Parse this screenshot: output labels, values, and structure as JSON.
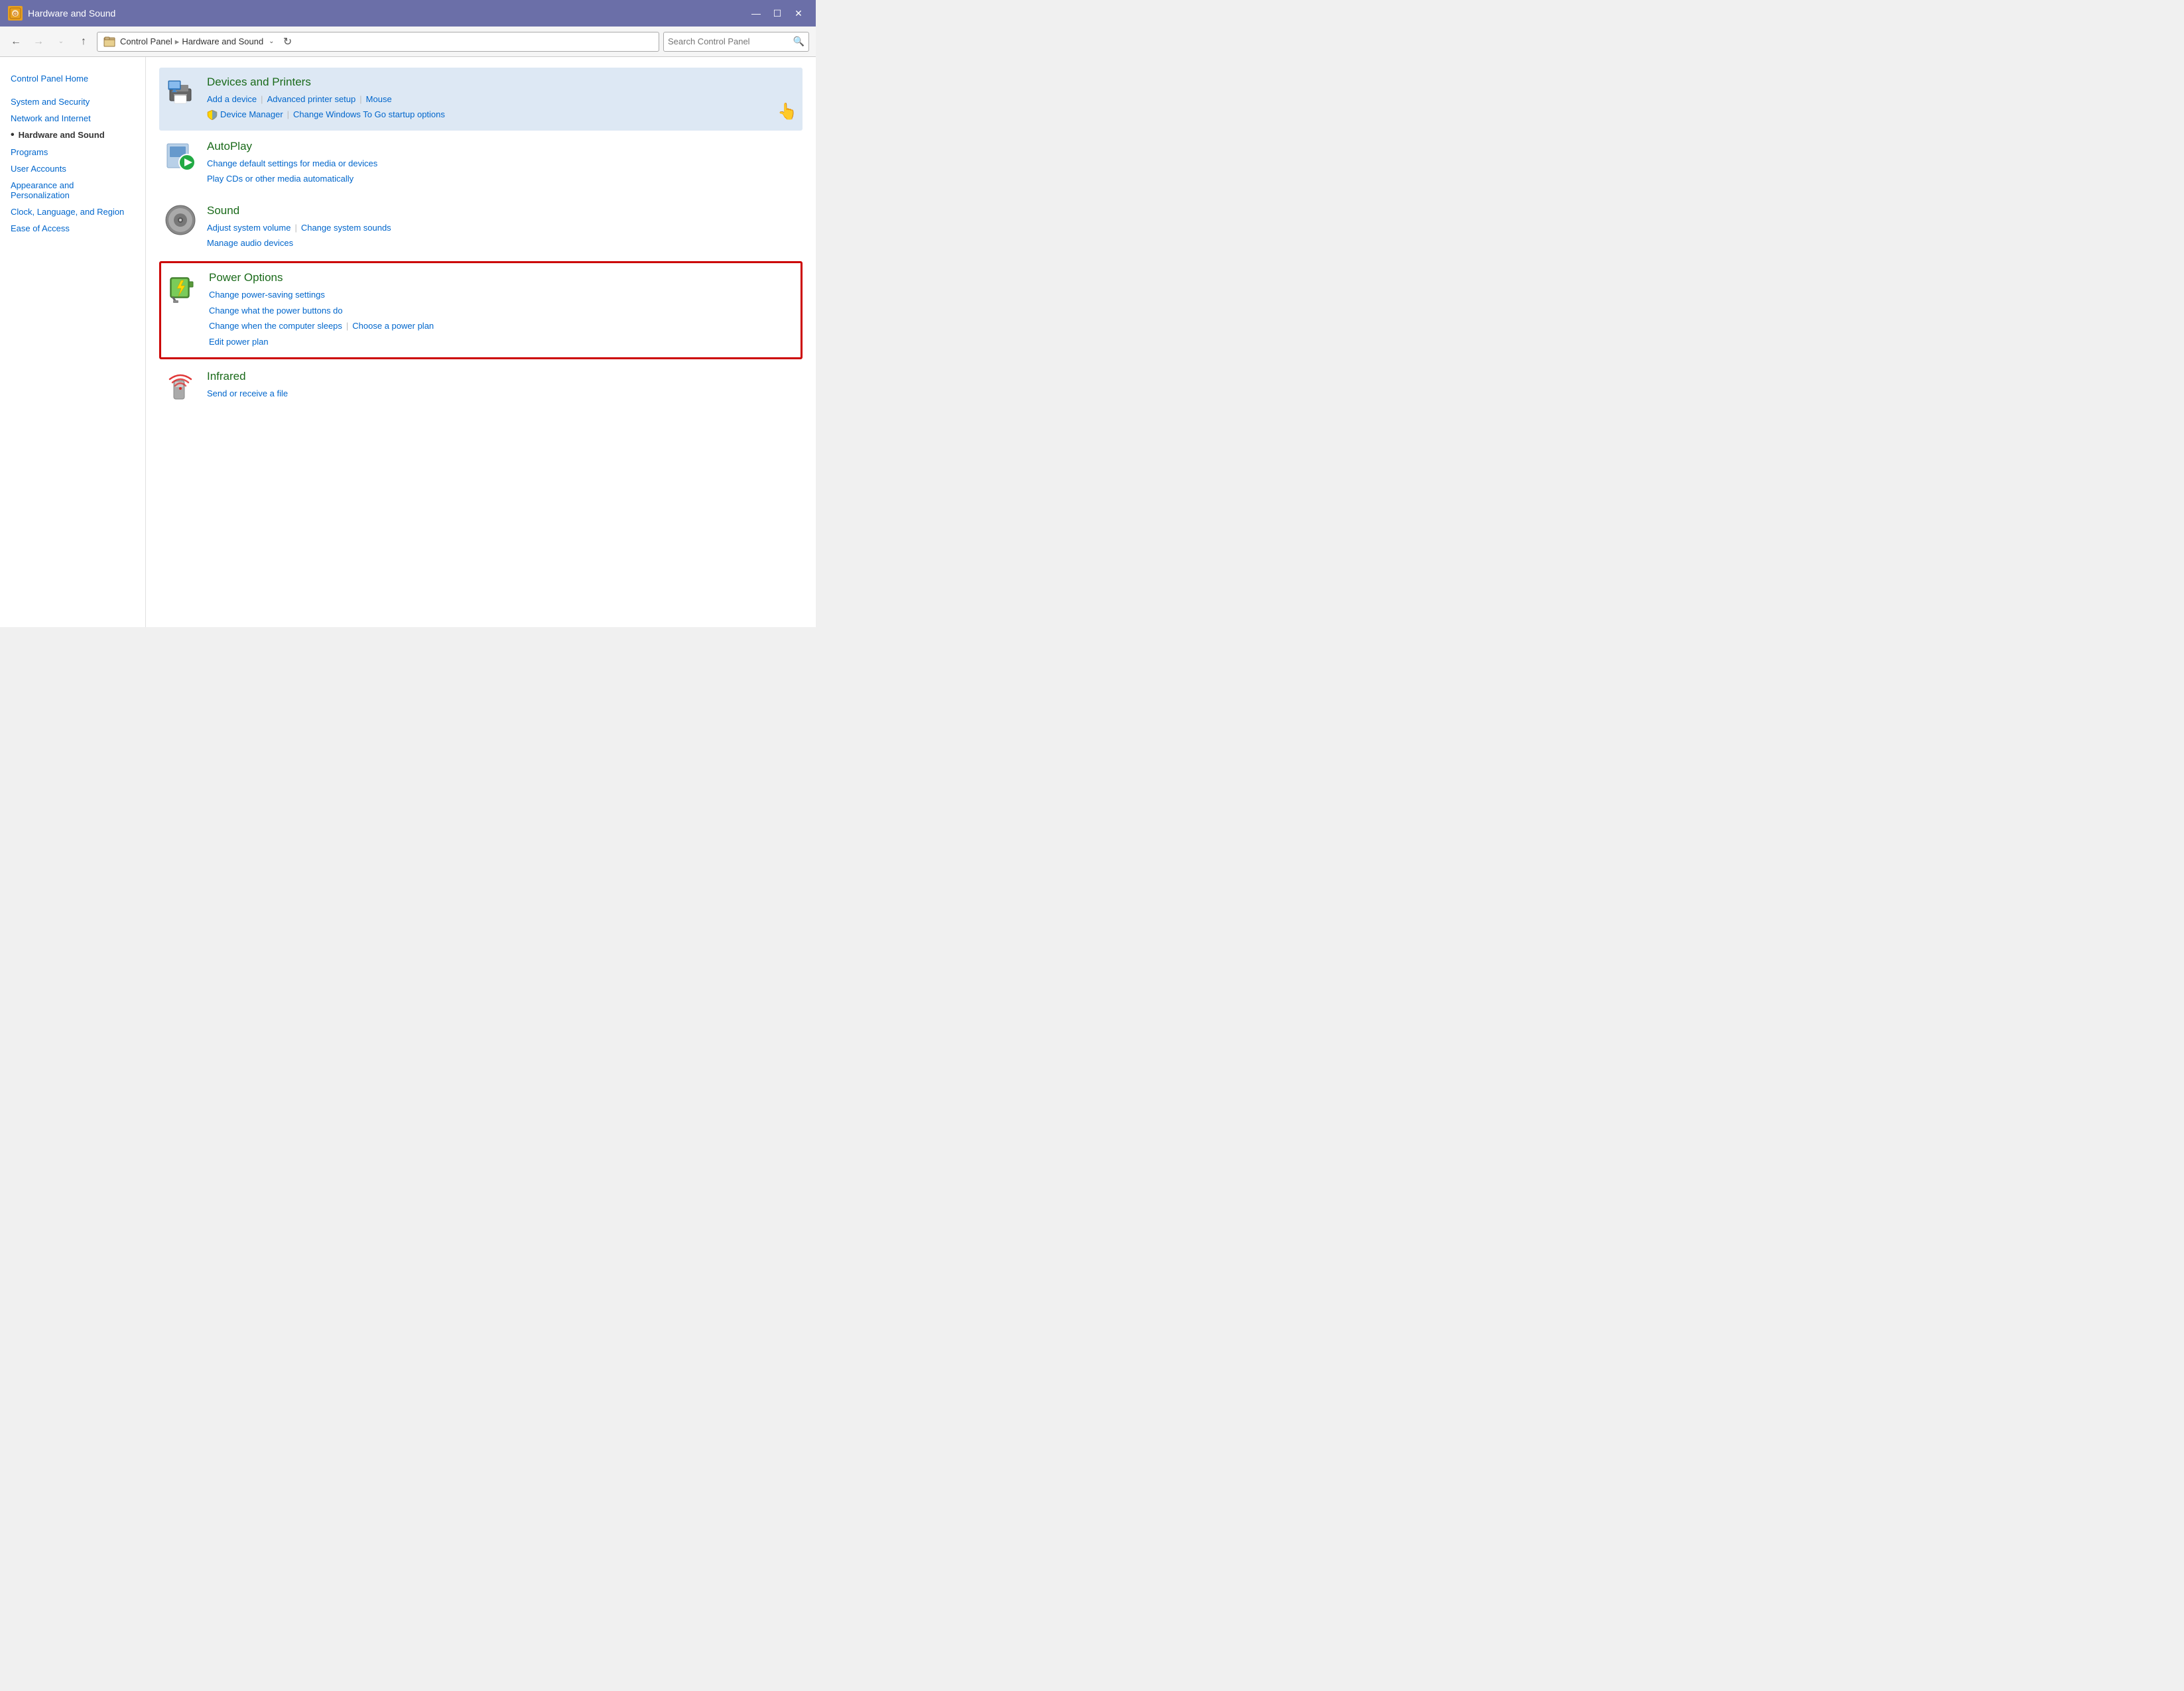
{
  "window": {
    "title": "Hardware and Sound",
    "icon": "🔧",
    "controls": {
      "minimize": "—",
      "maximize": "☐",
      "close": "✕"
    }
  },
  "addressBar": {
    "back": "←",
    "forward": "→",
    "dropdown": "∨",
    "up": "↑",
    "refresh": "↺",
    "path": {
      "root": "Control Panel",
      "current": "Hardware and Sound"
    },
    "search_placeholder": "Search Control Panel"
  },
  "sidebar": {
    "items": [
      {
        "label": "Control Panel Home",
        "active": false
      },
      {
        "label": "System and Security",
        "active": false
      },
      {
        "label": "Network and Internet",
        "active": false
      },
      {
        "label": "Hardware and Sound",
        "active": true
      },
      {
        "label": "Programs",
        "active": false
      },
      {
        "label": "User Accounts",
        "active": false
      },
      {
        "label": "Appearance and Personalization",
        "active": false
      },
      {
        "label": "Clock, Language, and Region",
        "active": false
      },
      {
        "label": "Ease of Access",
        "active": false
      }
    ]
  },
  "sections": [
    {
      "id": "devices-and-printers",
      "title": "Devices and Printers",
      "highlighted": true,
      "links": [
        {
          "label": "Add a device"
        },
        {
          "sep": true
        },
        {
          "label": "Advanced printer setup"
        },
        {
          "sep": true
        },
        {
          "label": "Mouse"
        }
      ],
      "links2": [
        {
          "label": "Device Manager",
          "shield": true
        },
        {
          "sep": true
        },
        {
          "label": "Change Windows To Go startup options"
        }
      ]
    },
    {
      "id": "autoplay",
      "title": "AutoPlay",
      "links": [
        {
          "label": "Change default settings for media or devices"
        },
        {
          "sep": false
        }
      ],
      "links2": [
        {
          "label": "Play CDs or other media automatically"
        }
      ]
    },
    {
      "id": "sound",
      "title": "Sound",
      "links": [
        {
          "label": "Adjust system volume"
        },
        {
          "sep": true
        },
        {
          "label": "Change system sounds"
        },
        {
          "sep": false
        }
      ],
      "links2": [
        {
          "label": "Manage audio devices"
        }
      ]
    },
    {
      "id": "power-options",
      "title": "Power Options",
      "highlighted_border": true,
      "links": [
        {
          "label": "Change power-saving settings"
        },
        {
          "sep": false
        }
      ],
      "links2": [
        {
          "label": "Change what the power buttons do"
        }
      ],
      "links3": [
        {
          "label": "Change when the computer sleeps"
        },
        {
          "sep": true
        },
        {
          "label": "Choose a power plan"
        }
      ],
      "links4": [
        {
          "label": "Edit power plan"
        }
      ]
    },
    {
      "id": "infrared",
      "title": "Infrared",
      "links": [
        {
          "label": "Send or receive a file"
        }
      ]
    }
  ]
}
